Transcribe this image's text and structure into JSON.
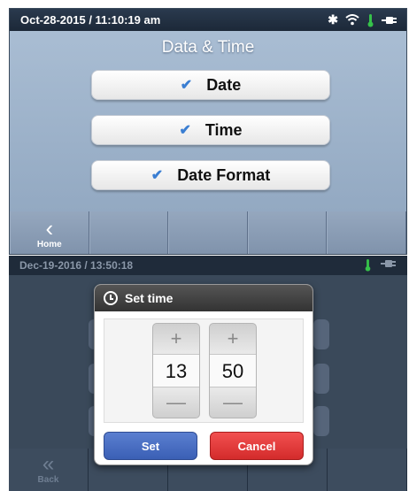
{
  "screen1": {
    "status": {
      "datetime": "Oct-28-2015 / 11:10:19 am",
      "icons": [
        "bluetooth-icon",
        "wifi-icon",
        "thermometer-icon",
        "plug-icon"
      ]
    },
    "title": "Data & Time",
    "options": [
      {
        "label": "Date",
        "checked": true
      },
      {
        "label": "Time",
        "checked": true
      },
      {
        "label": "Date Format",
        "checked": true
      }
    ],
    "nav": {
      "home_label": "Home"
    }
  },
  "screen2": {
    "status": {
      "datetime": "Dec-19-2016 / 13:50:18",
      "icons": [
        "thermometer-icon",
        "plug-icon"
      ]
    },
    "nav": {
      "back_label": "Back"
    },
    "dialog": {
      "title": "Set time",
      "hour": "13",
      "minute": "50",
      "set_label": "Set",
      "cancel_label": "Cancel"
    }
  },
  "colors": {
    "accent_check": "#3a7ed2",
    "set_button": "#3a5fb5",
    "cancel_button": "#d32b2b",
    "thermometer": "#36c24a"
  }
}
